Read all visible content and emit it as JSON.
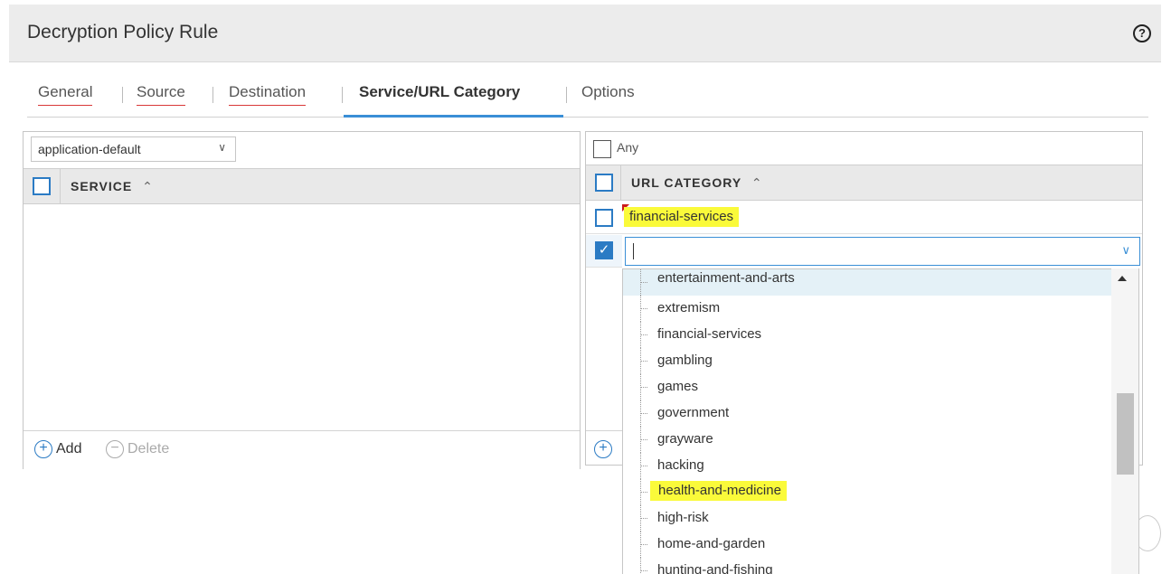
{
  "dialog": {
    "title": "Decryption Policy Rule",
    "help_icon": "question-mark-circle-icon",
    "help_glyph": "?"
  },
  "tabs": [
    {
      "label": "General",
      "state": "invalid"
    },
    {
      "label": "Source",
      "state": "invalid"
    },
    {
      "label": "Destination",
      "state": "invalid"
    },
    {
      "label": "Service/URL Category",
      "state": "active"
    },
    {
      "label": "Options",
      "state": "normal"
    }
  ],
  "service_panel": {
    "select_value": "application-default",
    "column_header": "SERVICE",
    "sort_glyph": "^",
    "add_label": "Add",
    "delete_label": "Delete"
  },
  "url_panel": {
    "any_label": "Any",
    "any_checked": false,
    "column_header": "URL CATEGORY",
    "sort_glyph": "^",
    "rows": [
      {
        "value": "financial-services",
        "checked": false,
        "highlighted": true,
        "flag": "red-corner"
      }
    ],
    "editing_row_checked": true,
    "input_value": ""
  },
  "dropdown": {
    "items": [
      {
        "label": "entertainment-and-arts",
        "hover": true,
        "highlighted": false
      },
      {
        "label": "extremism",
        "hover": false,
        "highlighted": false
      },
      {
        "label": "financial-services",
        "hover": false,
        "highlighted": false
      },
      {
        "label": "gambling",
        "hover": false,
        "highlighted": false
      },
      {
        "label": "games",
        "hover": false,
        "highlighted": false
      },
      {
        "label": "government",
        "hover": false,
        "highlighted": false
      },
      {
        "label": "grayware",
        "hover": false,
        "highlighted": false
      },
      {
        "label": "hacking",
        "hover": false,
        "highlighted": false
      },
      {
        "label": "health-and-medicine",
        "hover": false,
        "highlighted": true
      },
      {
        "label": "high-risk",
        "hover": false,
        "highlighted": false
      },
      {
        "label": "home-and-garden",
        "hover": false,
        "highlighted": false
      },
      {
        "label": "hunting-and-fishing",
        "hover": false,
        "highlighted": false
      }
    ]
  },
  "colors": {
    "accent": "#3a8fd6",
    "checkbox": "#2b7bc4",
    "highlight": "#fafa3a",
    "invalid_underline": "#d93838"
  }
}
